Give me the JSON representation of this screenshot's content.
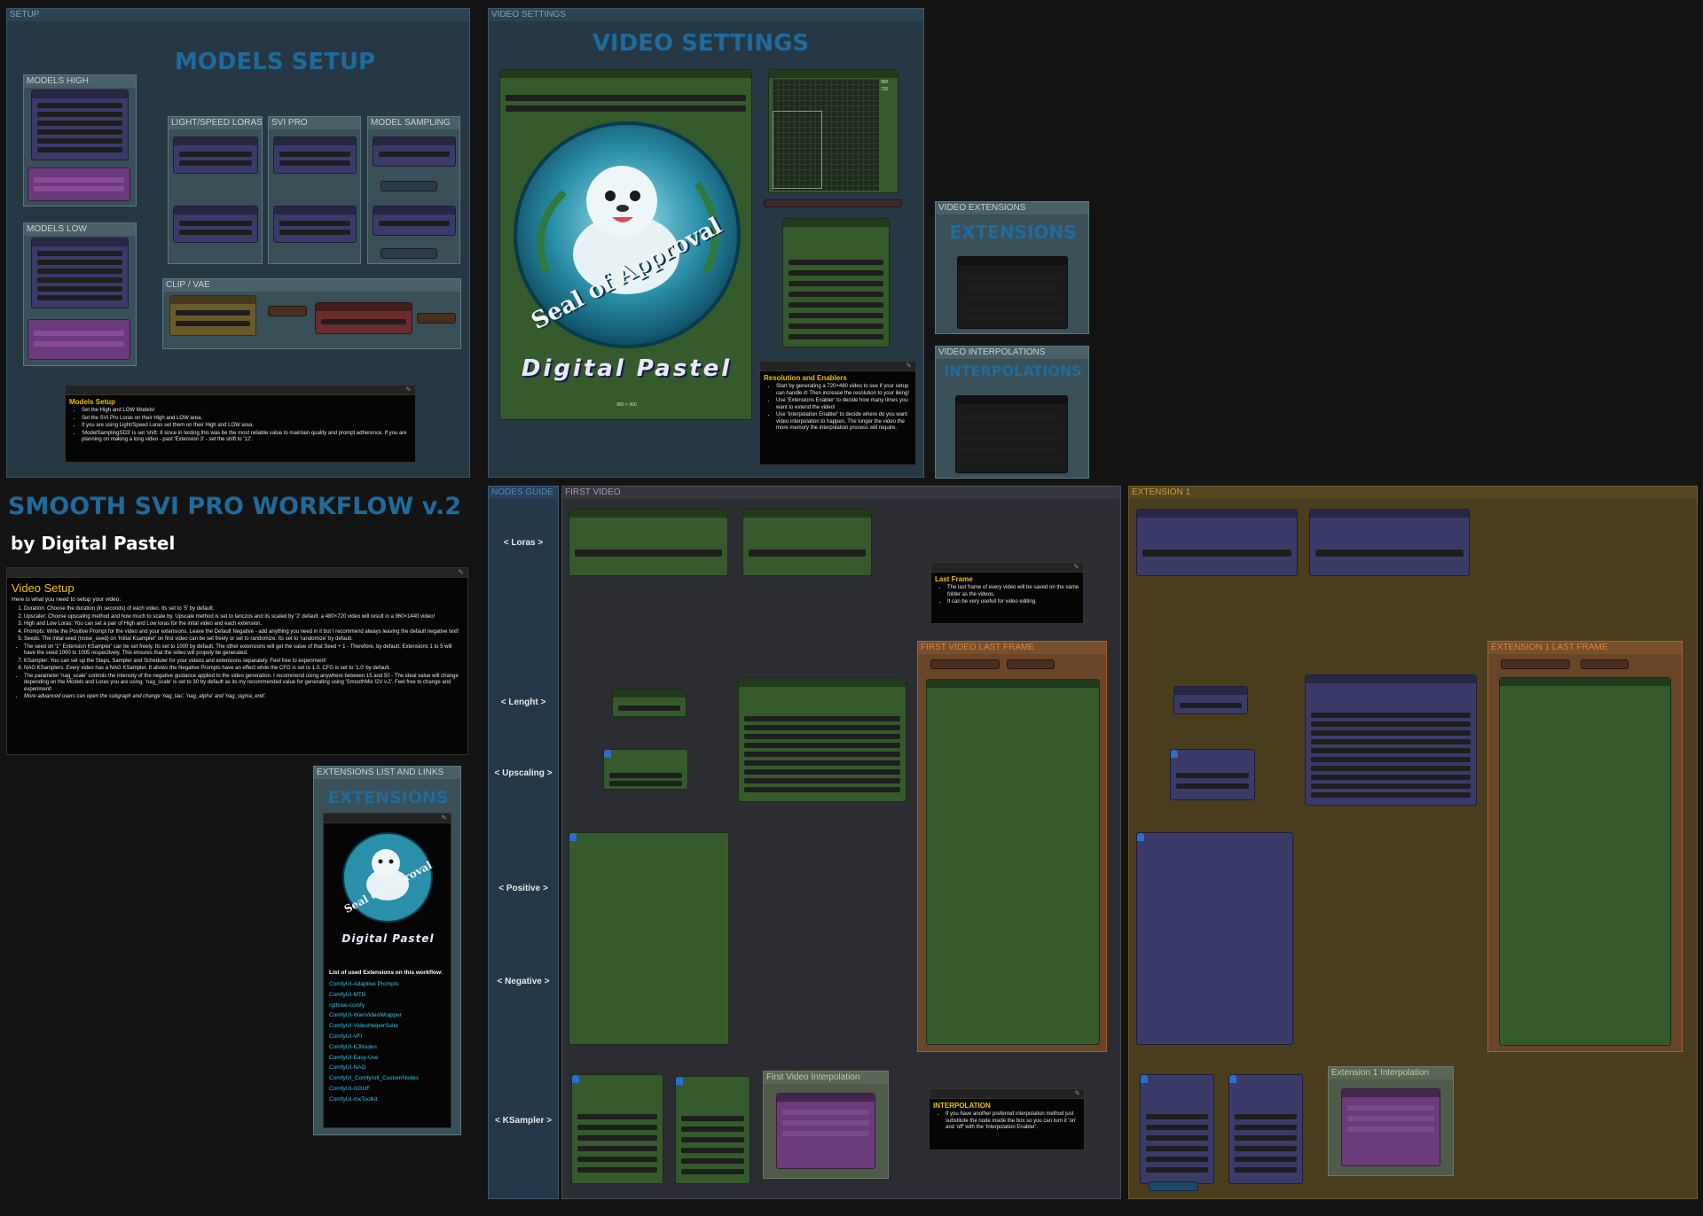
{
  "groups": {
    "setup": "SETUP",
    "video_settings": "VIDEO SETTINGS",
    "models_high": "MODELS HIGH",
    "models_low": "MODELS LOW",
    "light_speed_loras": "LIGHT/SPEED LORAS",
    "svi_pro": "SVI PRO",
    "model_sampling": "MODEL SAMPLING",
    "clip_vae": "CLIP / VAE",
    "video_extensions": "VIDEO EXTENSIONS",
    "video_interpolations": "VIDEO INTERPOLATIONS",
    "extensions_list": "EXTENSIONS LIST AND LINKS",
    "nodes_guide": "NODES GUIDE",
    "first_video": "FIRST VIDEO",
    "first_video_last_frame": "FIRST VIDEO LAST FRAME",
    "first_video_interpolation": "First Video Interpolation",
    "extension_1": "EXTENSION 1",
    "extension_1_last_frame": "EXTENSION 1 LAST FRAME",
    "extension_1_interpolation": "Extension 1 Interpolation"
  },
  "headings": {
    "models_setup": "MODELS SETUP",
    "video_settings": "VIDEO SETTINGS",
    "extensions": "EXTENSIONS",
    "interpolations": "INTERPOLATIONS",
    "extensions_list": "EXTENSIONS",
    "workflow_title": "SMOOTH SVI PRO WORKFLOW v.2",
    "byline": "by Digital Pastel"
  },
  "logo": {
    "text": "Seal of Approval",
    "brand": "Digital Pastel",
    "caption": "960 × 960"
  },
  "notes": {
    "models_setup": {
      "title": "Models Setup",
      "items": [
        "Set the High and LOW Models!",
        "Set the SVI Pro Loras on their High and LOW area.",
        "If you are using Light/Speed Loras set them on their High and LOW area.",
        "'ModelSamplingSD3' is set 'shift: 8 since in testing this was be the most reliable value to maintain quality and prompt adherence. If you are planning on making a long video - past 'Extension 3' - set the shift to '12'."
      ]
    },
    "resolution": {
      "title": "Resolution and Enablers",
      "items": [
        "Start by generating a 720×480 video to see if your setup can handle it! Then increase the resolution to your liking!",
        "Use 'Extensions Enabler' to decide how many times you want to extend the video!",
        "Use 'Interpolation Enabler' to decide where do you want video interpolation to happen. The longer the video the more memory the interpolation process will require."
      ]
    },
    "video_setup": {
      "title": "Video Setup",
      "intro": "Here is what you need to setup your video:",
      "items": [
        "Duration: Choose the duration (in seconds) of each video. Its set to '5' by default.",
        "Upscaler: Choose upscaling method and how much to scale by. Upscale method is set to lanczos and its scaled by '2' default. a 480×720 video will result in a 960×1440 video!",
        "High and Low Loras: You can set a pair of High and Low loras for the inital video and each extension.",
        "Prompts: Write the Positive Prompt for the video and your extensions. Leave the Default Negative - add anything you need in it but I recommend always leaving the default negative text!",
        "Seeds: The inital seed (noise_seed) on 'Initial Ksampler' on first video can be set freely or set to randomize. Its set to 'randomize' by default.",
        "The seed on '1° Extension KSampler' can be set freely. Its set to 1000 by default. The other extensions will get the value of that Seed + 1 - Therefore, by default, Extensions 1 to 5 will have the seed 1000 to 1005 respectively. This ensures that the video will propely be generated.",
        "KSampler: You can set up the Steps, Sampler and Scheduler for your videos and extensions separately. Feel free to experiment!",
        "NAG KSamplers: Every video has a NAG KSampler. It allows the Negative Prompts have an effect while the CFG is set to 1.0. CFG is set to '1.0' by default.",
        "The parameter 'nag_scale' controls the intensity of the negative guidance applied to the video generation. I recommend using anywhere between 15 and 50 - The ideal value will change depending on the Models and Loras you are using. 'nag_scale' is set to 30 by default as its my recommended value for generating using 'SmoothMix I2V v.2'. Feel free to change and experiment!",
        "More advanced users can open the subgraph and change 'nag_tau', 'nag_alpha' and 'nag_sigma_end'."
      ]
    },
    "last_frame": {
      "title": "Last Frame",
      "items": [
        "The last frame of every video will be saved on the same folder as the videos.",
        "It can be very usefull for video editing."
      ]
    },
    "interpolation": {
      "title": "INTERPOLATION",
      "items": [
        "If you have another preferred interpolation method just substitute the node inside the box so you can turn it 'on' and 'off' with the 'Interpolation Enabler'."
      ]
    }
  },
  "extensions_list": {
    "heading": "List of used Extensions on this workflow:",
    "links": [
      "ComfyUI-Adaptive Prompts",
      "ComfyUI-MTB",
      "rgthree-comfy",
      "ComfyUI-WanVideoWrapper",
      "ComfyUI-VideoHelperSuite",
      "ComfyUI-VFI",
      "ComfyUI-KJNodes",
      "ComfyUI-Easy-Use",
      "ComfyUI-NAG",
      "ComfyUI_Comfyroll_CustomNodes",
      "ComfyUI-GGUF",
      "ComfyUI-mxToolkit"
    ]
  },
  "guide": {
    "loras": "< Loras >",
    "length": "< Lenght >",
    "upscaling": "< Upscaling >",
    "positive": "< Positive >",
    "negative": "< Negative >",
    "ksampler": "< KSampler >"
  },
  "canvas_readout": [
    "960",
    "720"
  ],
  "colors": {
    "title_blue": "#1e6b9c",
    "note_title": "#f0c000",
    "link_cyan": "#2ec7e8"
  }
}
